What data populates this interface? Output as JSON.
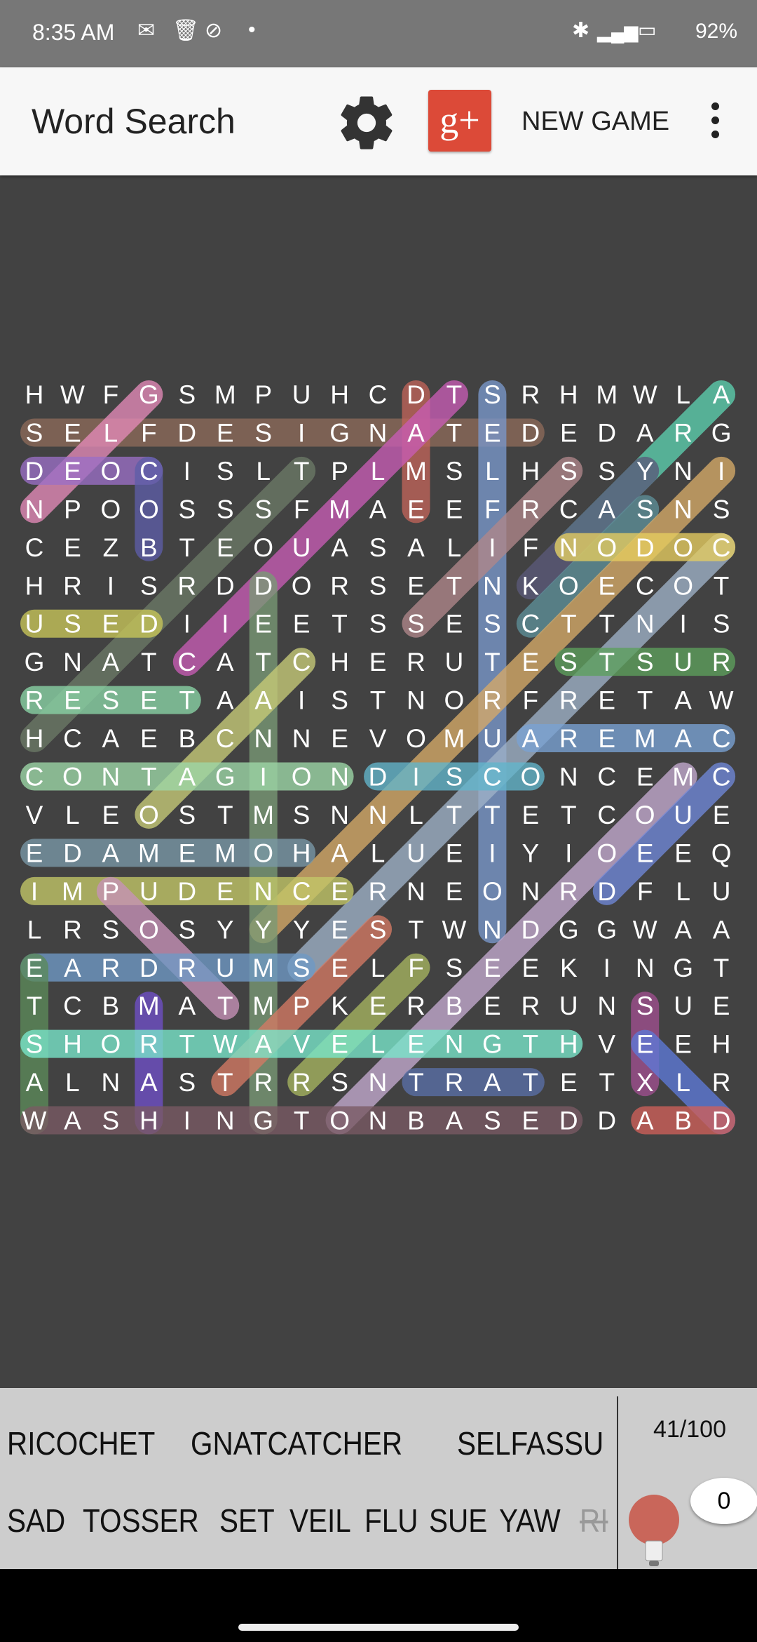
{
  "status_bar": {
    "time": "8:35 AM",
    "battery": "92%",
    "icons": [
      "gmail-icon",
      "trash-icon",
      "vpn-icon",
      "dot-icon",
      "bluetooth-icon",
      "signal-icon",
      "battery-charging-icon"
    ]
  },
  "app_bar": {
    "title": "Word Search",
    "new_game_label": "NEW GAME",
    "icons": [
      "gear-icon",
      "google-plus-icon",
      "more-vert-icon"
    ],
    "gplus_text": "g+"
  },
  "grid": {
    "rows": [
      "HWFGSMPUHCDTSRHMWLA",
      "SELFDESIGNATEDEDARG",
      "DEOCISLTPLMSLHSSYNI",
      "NPOOSSSFMAEEFRCASNS",
      "CEZBTEOUASALIFNODOC",
      "HRISRDDORSETNKOECOT",
      "USEDIIEETSSESCTTNIS",
      "GNATCATCHERUTESTSUR",
      "RESETAAISTNORFRETAW",
      "HCAEBCNNEVOMUAREMAC",
      "CONTAGIONDISCONCEMC",
      "VLEOSTMSNNLTTETCOUE",
      "EDAMEMOHALUEIYIOEEQ",
      "IMPUDENCERNEONRDFLU",
      "LRSOSYYYESTWNDGGWAA",
      "EARDRUMSELFSEEKINGT",
      "TCBMATMPKERBERUNSUE",
      "SHORTWAVELENGTHVEEH",
      "ALNASTRRSNTRATETXLR",
      "WASHINGTONBASEDDABD"
    ],
    "found": [
      {
        "from": [
          1,
          0
        ],
        "to": [
          1,
          13
        ],
        "color": "#8d6a5a"
      },
      {
        "from": [
          0,
          3
        ],
        "to": [
          3,
          0
        ],
        "color": "#e48ab8"
      },
      {
        "from": [
          2,
          0
        ],
        "to": [
          2,
          3
        ],
        "color": "#9b6fc6"
      },
      {
        "from": [
          2,
          3
        ],
        "to": [
          4,
          3
        ],
        "color": "#5e5ea8"
      },
      {
        "from": [
          0,
          10
        ],
        "to": [
          3,
          10
        ],
        "color": "#c0645a"
      },
      {
        "from": [
          0,
          11
        ],
        "to": [
          7,
          4
        ],
        "color": "#c85cb4"
      },
      {
        "from": [
          0,
          12
        ],
        "to": [
          14,
          12
        ],
        "color": "#7a98cc"
      },
      {
        "from": [
          0,
          18
        ],
        "to": [
          4,
          14
        ],
        "color": "#5ccfae"
      },
      {
        "from": [
          2,
          16
        ],
        "to": [
          5,
          13
        ],
        "color": "#5b5a7a"
      },
      {
        "from": [
          3,
          16
        ],
        "to": [
          6,
          13
        ],
        "color": "#5e8f99"
      },
      {
        "from": [
          2,
          7
        ],
        "to": [
          9,
          0
        ],
        "color": "#6c7a66"
      },
      {
        "from": [
          2,
          14
        ],
        "to": [
          6,
          10
        ],
        "color": "#b0878a"
      },
      {
        "from": [
          2,
          18
        ],
        "to": [
          14,
          6
        ],
        "color": "#d6aa68"
      },
      {
        "from": [
          4,
          18
        ],
        "to": [
          15,
          7
        ],
        "color": "#9fb2c8"
      },
      {
        "from": [
          4,
          14
        ],
        "to": [
          4,
          18
        ],
        "color": "#e6cd60"
      },
      {
        "from": [
          5,
          6
        ],
        "to": [
          19,
          6
        ],
        "color": "#7a9a76"
      },
      {
        "from": [
          6,
          0
        ],
        "to": [
          6,
          3
        ],
        "color": "#c9c75a"
      },
      {
        "from": [
          7,
          14
        ],
        "to": [
          7,
          18
        ],
        "color": "#5da05c"
      },
      {
        "from": [
          8,
          0
        ],
        "to": [
          8,
          4
        ],
        "color": "#8ad4a6"
      },
      {
        "from": [
          7,
          7
        ],
        "to": [
          11,
          3
        ],
        "color": "#c8cc78"
      },
      {
        "from": [
          9,
          13
        ],
        "to": [
          9,
          18
        ],
        "color": "#7aa2d4"
      },
      {
        "from": [
          10,
          0
        ],
        "to": [
          10,
          8
        ],
        "color": "#9ed8a8"
      },
      {
        "from": [
          10,
          9
        ],
        "to": [
          10,
          13
        ],
        "color": "#62b6cc"
      },
      {
        "from": [
          10,
          17
        ],
        "to": [
          19,
          8
        ],
        "color": "#c4aad0"
      },
      {
        "from": [
          10,
          18
        ],
        "to": [
          13,
          15
        ],
        "color": "#7088d8"
      },
      {
        "from": [
          12,
          0
        ],
        "to": [
          12,
          7
        ],
        "color": "#7a98a8"
      },
      {
        "from": [
          13,
          0
        ],
        "to": [
          13,
          8
        ],
        "color": "#c4c868"
      },
      {
        "from": [
          13,
          2
        ],
        "to": [
          16,
          5
        ],
        "color": "#c892b8"
      },
      {
        "from": [
          14,
          9
        ],
        "to": [
          18,
          5
        ],
        "color": "#d47a64"
      },
      {
        "from": [
          15,
          0
        ],
        "to": [
          15,
          7
        ],
        "color": "#6f9ac6"
      },
      {
        "from": [
          15,
          10
        ],
        "to": [
          18,
          7
        ],
        "color": "#a6b460"
      },
      {
        "from": [
          15,
          0
        ],
        "to": [
          19,
          0
        ],
        "color": "#5c8a5a"
      },
      {
        "from": [
          16,
          3
        ],
        "to": [
          19,
          3
        ],
        "color": "#7050c8"
      },
      {
        "from": [
          17,
          0
        ],
        "to": [
          17,
          14
        ],
        "color": "#7ae8cc"
      },
      {
        "from": [
          18,
          10
        ],
        "to": [
          18,
          13
        ],
        "color": "#5a70a8"
      },
      {
        "from": [
          19,
          0
        ],
        "to": [
          19,
          14
        ],
        "color": "#7a5a64"
      },
      {
        "from": [
          16,
          16
        ],
        "to": [
          18,
          16
        ],
        "color": "#a05090"
      },
      {
        "from": [
          17,
          16
        ],
        "to": [
          19,
          18
        ],
        "color": "#5e7ad8"
      },
      {
        "from": [
          19,
          16
        ],
        "to": [
          19,
          18
        ],
        "color": "#d0605a"
      }
    ]
  },
  "word_bank": {
    "row1": [
      "RICOCHET",
      "GNATCATCHER",
      "SELFASSU"
    ],
    "row2": [
      "SAD",
      "TOSSER",
      "SET",
      "VEIL",
      "FLU",
      "SUE",
      "YAW"
    ],
    "found_partial": "RI",
    "progress": "41/100",
    "hints": "0"
  }
}
